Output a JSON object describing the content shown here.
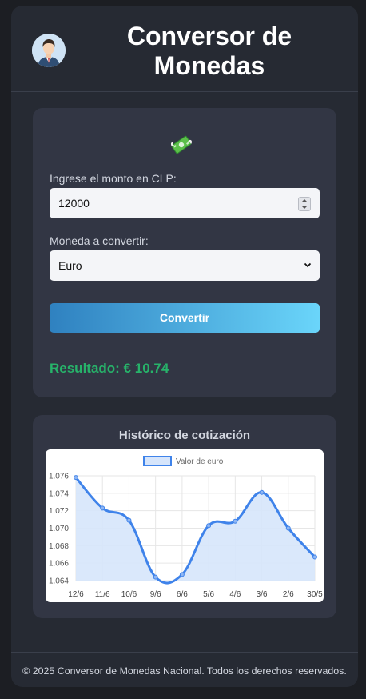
{
  "header": {
    "title_line1": "Conversor de",
    "title_line2": "Monedas",
    "avatar_icon": "businessman-avatar-icon"
  },
  "form": {
    "icon": "flying-money-icon",
    "amount_label": "Ingrese el monto en CLP:",
    "amount_value": "12000",
    "currency_label": "Moneda a convertir:",
    "currency_value": "Euro",
    "convert_button": "Convertir",
    "result_label": "Resultado: € 10.74"
  },
  "chart": {
    "title": "Histórico de cotización"
  },
  "chart_data": {
    "type": "line",
    "legend": [
      "Valor de euro"
    ],
    "legend_position": "top",
    "categories": [
      "12/6",
      "11/6",
      "10/6",
      "9/6",
      "6/6",
      "5/6",
      "4/6",
      "3/6",
      "2/6",
      "30/5"
    ],
    "series": [
      {
        "name": "Valor de euro",
        "values": [
          1.0758,
          1.0723,
          1.0709,
          1.0644,
          1.0647,
          1.0703,
          1.0708,
          1.0741,
          1.07,
          1.0667
        ],
        "color": "#3f83ea",
        "fill": "#d6e5fb"
      }
    ],
    "yticks": [
      "1.076",
      "1.074",
      "1.072",
      "1.070",
      "1.068",
      "1.066",
      "1.064"
    ],
    "ylim": [
      1.064,
      1.076
    ],
    "grid": true
  },
  "footer": {
    "text": "© 2025 Conversor de Monedas Nacional. Todos los derechos reservados."
  }
}
